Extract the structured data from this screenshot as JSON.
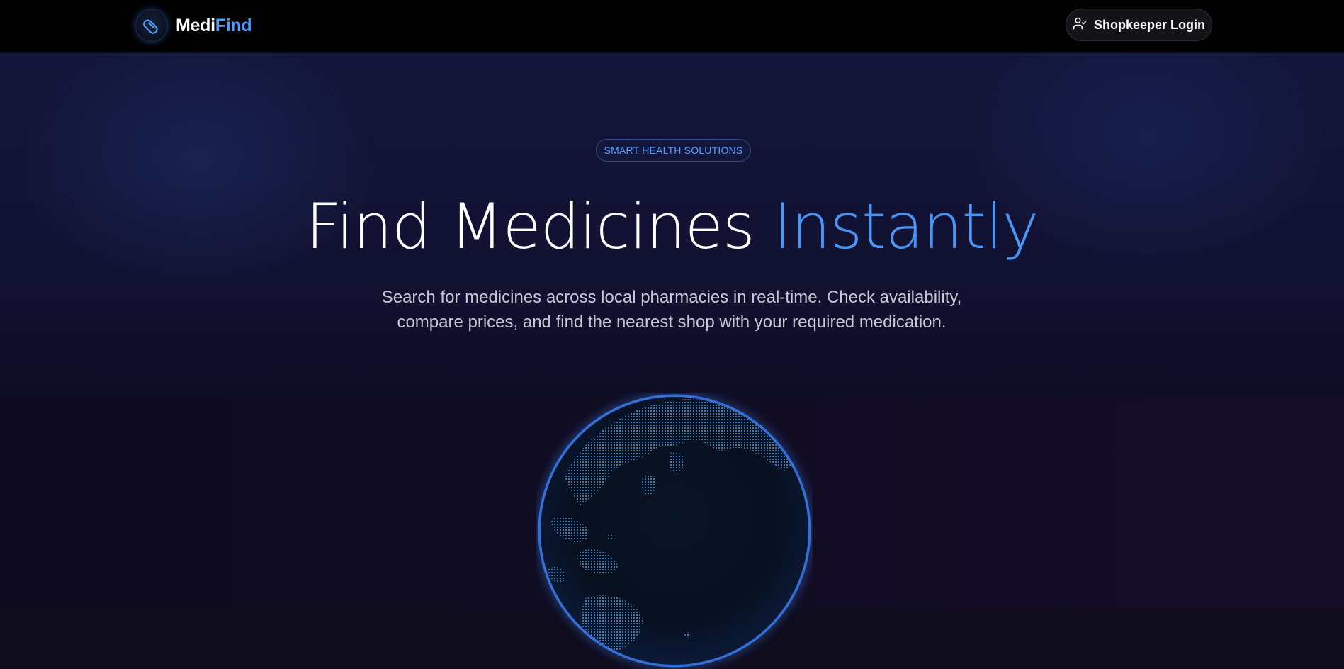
{
  "header": {
    "brand": {
      "part1": "Medi",
      "part2": "Find",
      "icon": "pill-icon"
    },
    "login_button": {
      "label": "Shopkeeper Login",
      "icon": "user-check-icon"
    }
  },
  "hero": {
    "badge": "SMART HEALTH SOLUTIONS",
    "headline": {
      "main": "Find Medicines",
      "accent": "Instantly"
    },
    "subtitle_line1": "Search for medicines across local pharmacies in real-time. Check availability,",
    "subtitle_line2": "compare prices, and find the nearest shop with your required medication.",
    "globe_icon": "globe-icon"
  },
  "colors": {
    "accent": "#4b95f5",
    "background": "#0f0c1e",
    "topbar": "#000000"
  }
}
